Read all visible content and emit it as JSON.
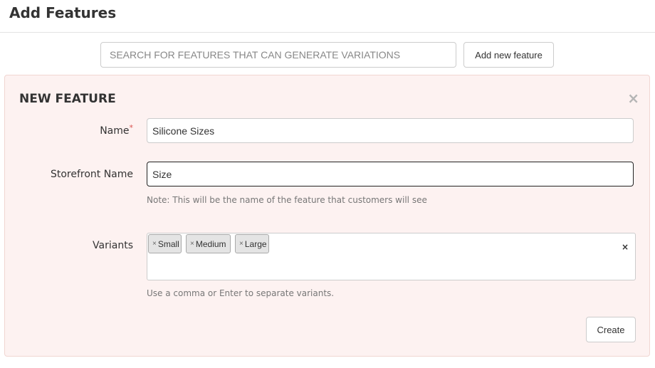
{
  "header": {
    "title": "Add Features"
  },
  "search": {
    "placeholder": "SEARCH FOR FEATURES THAT CAN GENERATE VARIATIONS"
  },
  "toolbar": {
    "add_new_feature_label": "Add new feature"
  },
  "panel": {
    "title": "NEW FEATURE",
    "close_glyph": "×",
    "name": {
      "label": "Name",
      "required_mark": "*",
      "value": "Silicone Sizes"
    },
    "storefront": {
      "label": "Storefront Name",
      "value": "Size",
      "note": "Note: This will be the name of the feature that customers will see"
    },
    "variants": {
      "label": "Variants",
      "remove_glyph": "×",
      "clear_glyph": "×",
      "tags": [
        {
          "label": "Small"
        },
        {
          "label": "Medium"
        },
        {
          "label": "Large"
        }
      ],
      "help": "Use a comma or Enter to separate variants."
    },
    "create_label": "Create"
  }
}
